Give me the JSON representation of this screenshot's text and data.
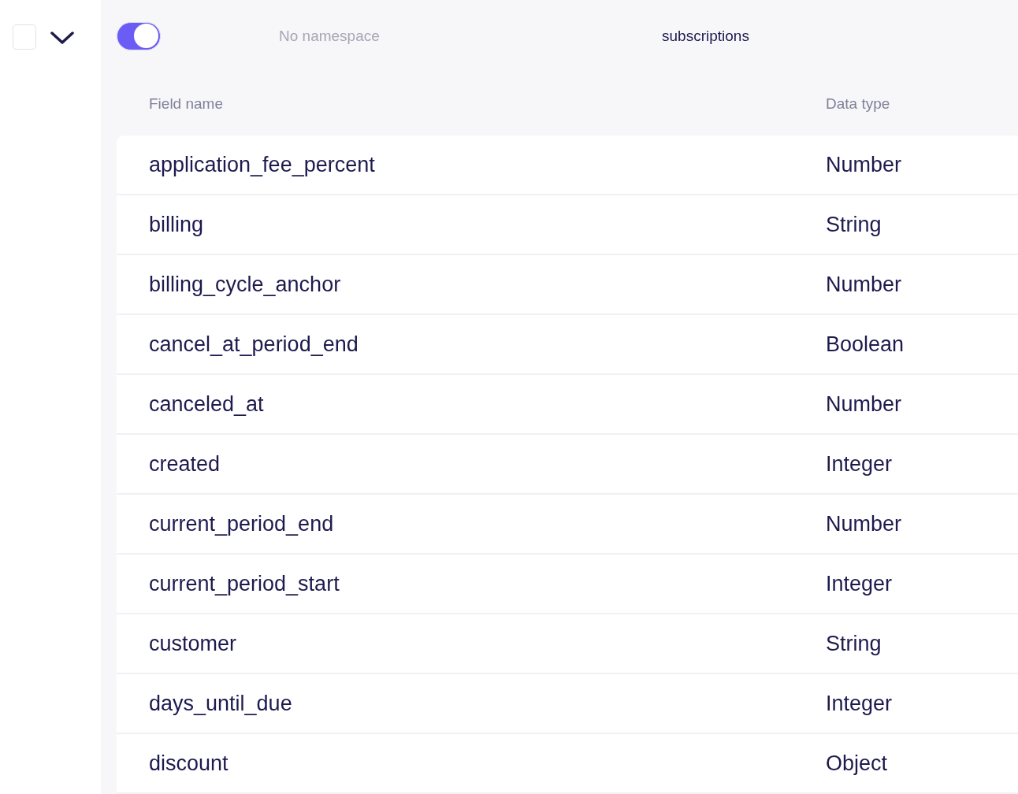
{
  "row_select": {
    "checked": false,
    "expanded": true
  },
  "toggle": {
    "on": true
  },
  "namespace": "No namespace",
  "collection": "subscriptions",
  "columns": [
    "Field name",
    "Data type"
  ],
  "rows": [
    {
      "field": "application_fee_percent",
      "type": "Number"
    },
    {
      "field": "billing",
      "type": "String"
    },
    {
      "field": "billing_cycle_anchor",
      "type": "Number"
    },
    {
      "field": "cancel_at_period_end",
      "type": "Boolean"
    },
    {
      "field": "canceled_at",
      "type": "Number"
    },
    {
      "field": "created",
      "type": "Integer"
    },
    {
      "field": "current_period_end",
      "type": "Number"
    },
    {
      "field": "current_period_start",
      "type": "Integer"
    },
    {
      "field": "customer",
      "type": "String"
    },
    {
      "field": "days_until_due",
      "type": "Integer"
    },
    {
      "field": "discount",
      "type": "Object"
    }
  ]
}
